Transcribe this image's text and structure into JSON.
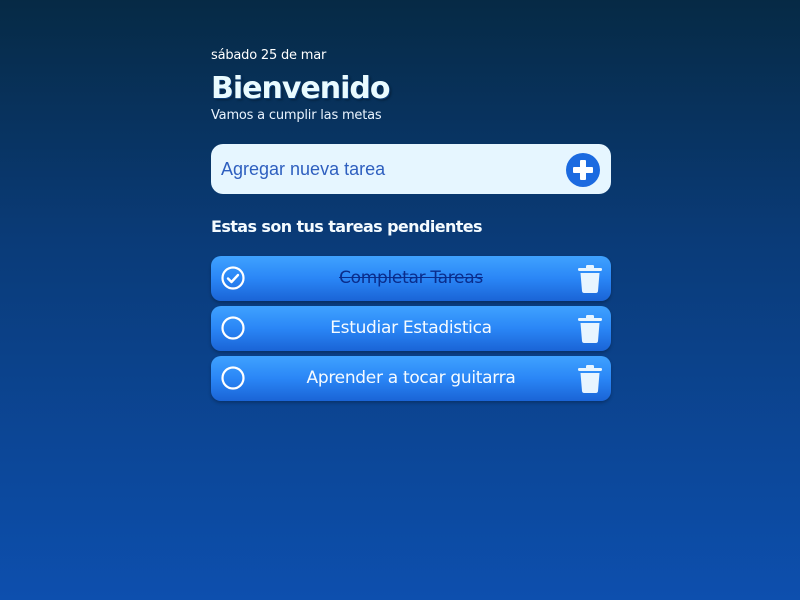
{
  "header": {
    "date": "sábado 25 de mar",
    "title": "Bienvenido",
    "subtitle": "Vamos a cumplir las metas"
  },
  "new_task": {
    "placeholder": "Agregar nueva tarea",
    "value": ""
  },
  "tasks_section": {
    "title": "Estas son tus tareas pendientes"
  },
  "tasks": [
    {
      "label": "Completar Tareas",
      "completed": true
    },
    {
      "label": "Estudiar Estadistica",
      "completed": false
    },
    {
      "label": "Aprender a tocar guitarra",
      "completed": false
    }
  ],
  "icons": {
    "add": "plus-circle-icon",
    "check_done": "check-circle-icon",
    "check_pending": "empty-circle-icon",
    "delete": "trash-icon"
  },
  "colors": {
    "accent": "#1b6ae0",
    "task_gradient_top": "#3fa2ff",
    "task_gradient_bottom": "#1a64d6",
    "completed_text": "#0a2d8c",
    "input_background": "#e6f6ff"
  }
}
